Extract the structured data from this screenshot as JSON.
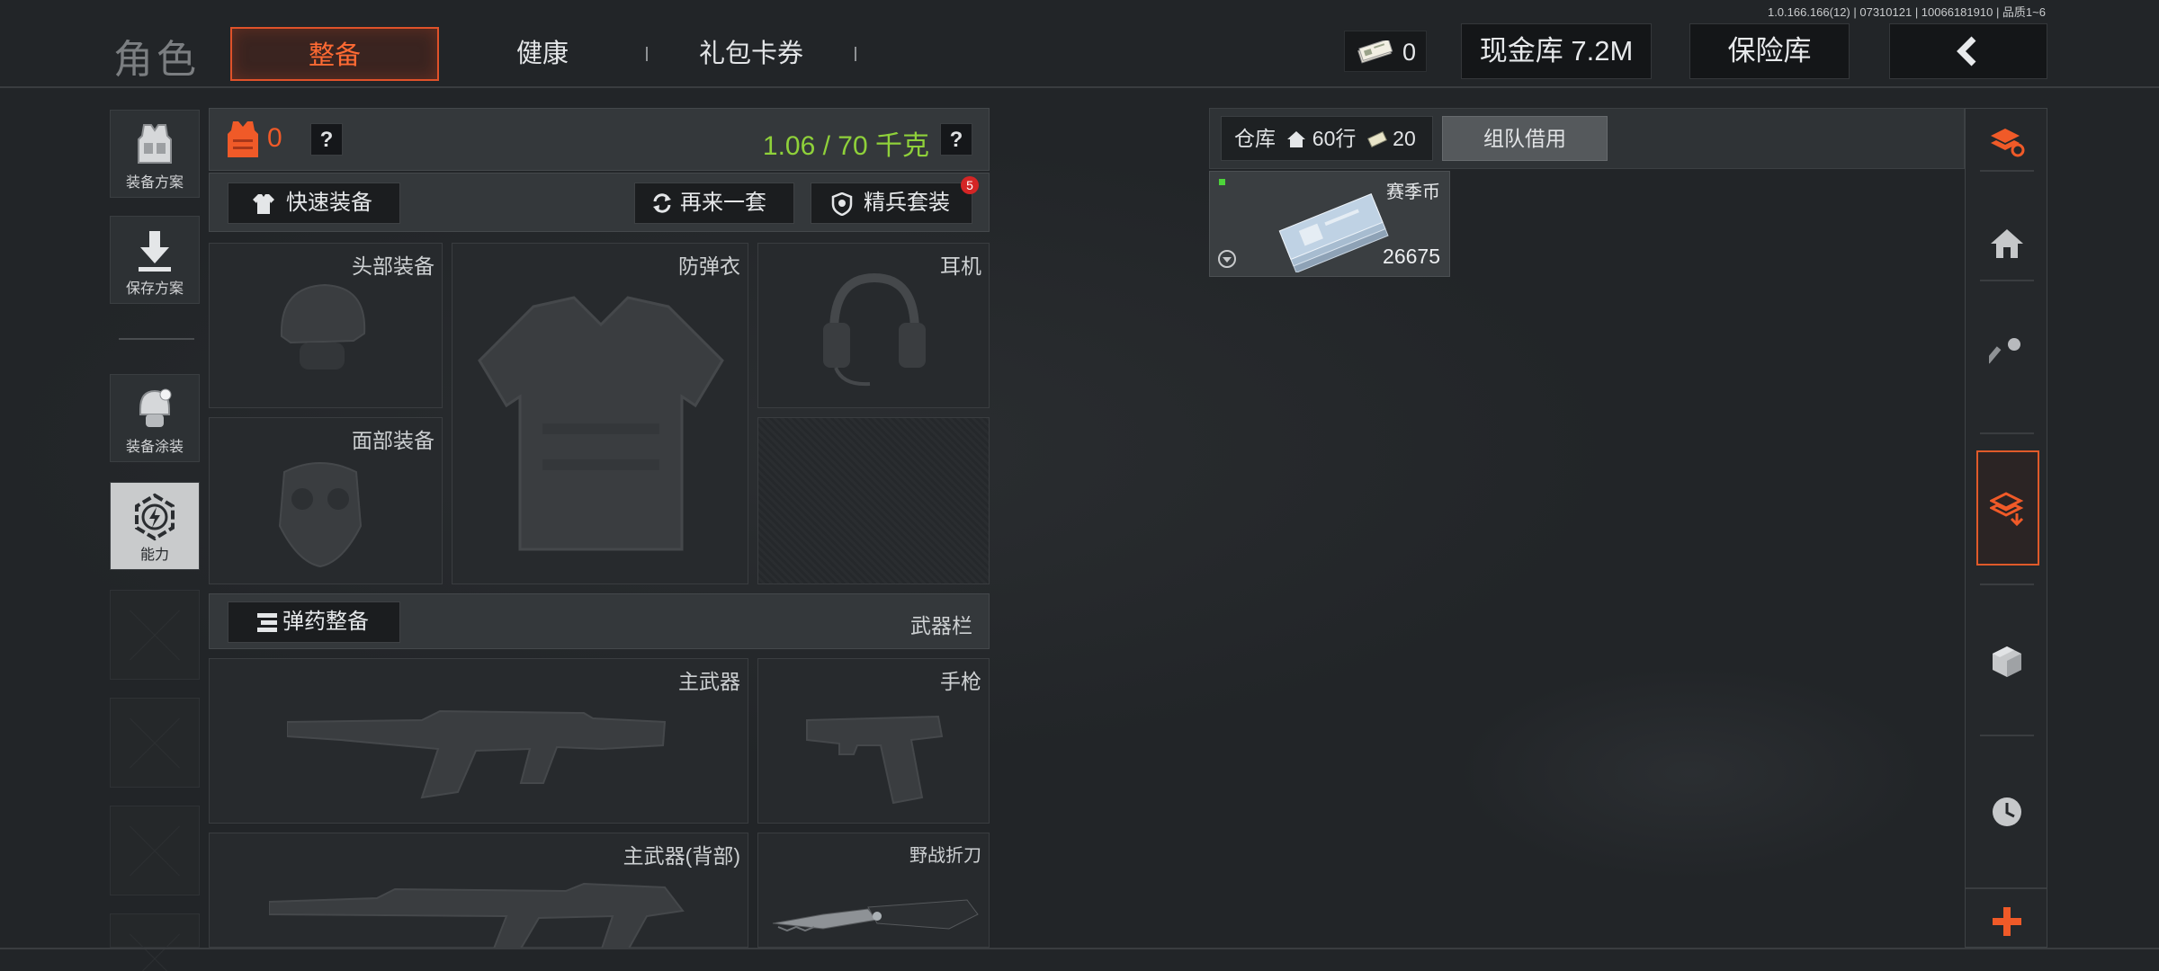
{
  "version_info": "1.0.166.166(12) | 07310121 | 10066181910 | 品质1~6",
  "page_title": "角色",
  "tabs": [
    {
      "label": "整备",
      "active": true
    },
    {
      "label": "健康",
      "active": false
    },
    {
      "label": "礼包卡券",
      "active": false
    }
  ],
  "header": {
    "cash_count": "0",
    "cash_vault_label": "现金库 7.2M",
    "safe_label": "保险库",
    "back_icon": "chevron-left-icon"
  },
  "sidebar": {
    "items": [
      {
        "label": "装备方案",
        "icon": "vest-icon"
      },
      {
        "label": "保存方案",
        "icon": "download-icon"
      },
      {
        "label": "装备涂装",
        "icon": "helmet-paint-icon"
      },
      {
        "label": "能力",
        "icon": "ability-icon",
        "active": true
      }
    ]
  },
  "equip": {
    "armor_count": "0",
    "help": "?",
    "weight": "1.06 / 70 千克",
    "quick_equip": "快速装备",
    "again": "再来一套",
    "elite": "精兵套装",
    "elite_badge": "5",
    "slots": {
      "head": "头部装备",
      "armor": "防弹衣",
      "headset": "耳机",
      "face": "面部装备"
    },
    "ammo": "弹药整备",
    "weapon_bar": "武器栏",
    "weapons": {
      "primary": "主武器",
      "pistol": "手枪",
      "primary_back": "主武器(背部)",
      "knife": "野战折刀"
    }
  },
  "stash": {
    "tab_label": "仓库",
    "rows": "60行",
    "cash_rows": "20行",
    "team_borrow": "组队借用",
    "item": {
      "name": "赛季币",
      "qty": "26675"
    }
  },
  "colors": {
    "accent": "#f05a28",
    "weight_green": "#8fd13a",
    "badge_red": "#d42525"
  }
}
